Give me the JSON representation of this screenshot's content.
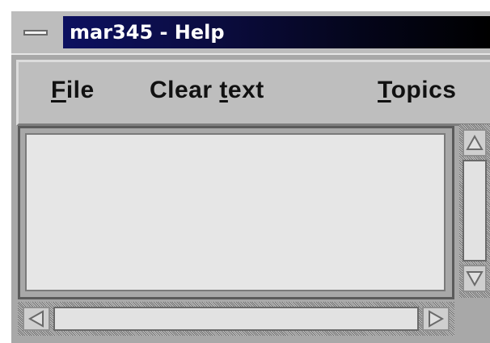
{
  "window": {
    "title": "mar345 - Help"
  },
  "menubar": {
    "items": [
      {
        "prefix": "",
        "mnemonic": "F",
        "rest": "ile"
      },
      {
        "prefix": "Clear ",
        "mnemonic": "t",
        "rest": "ext"
      },
      {
        "prefix": "",
        "mnemonic": "T",
        "rest": "opics"
      }
    ]
  },
  "text_area": {
    "content": ""
  },
  "icons": {
    "window_menu": "window-menu-icon",
    "up": "arrow-up-icon",
    "down": "arrow-down-icon",
    "left": "arrow-left-icon",
    "right": "arrow-right-icon"
  },
  "colors": {
    "title_gradient_start": "#0d1160",
    "title_gradient_end": "#000000",
    "window_bg": "#a8a8a8",
    "text_bg": "#e6e6e6"
  }
}
